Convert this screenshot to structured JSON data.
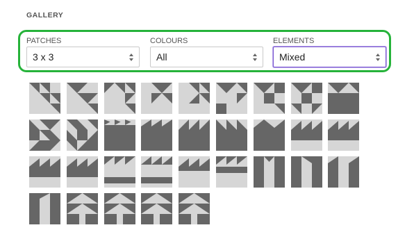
{
  "gallery": {
    "title": "GALLERY"
  },
  "filters": [
    {
      "label": "PATCHES",
      "value": "3 x 3"
    },
    {
      "label": "COLOURS",
      "value": "All"
    },
    {
      "label": "ELEMENTS",
      "value": "Mixed"
    }
  ],
  "colors": {
    "accent": "#26b33a",
    "dark": "#666666",
    "light": "#d6d6d6",
    "focus": "#7a57d1"
  },
  "thumbnails": [
    {
      "pattern": "tri-nw-1"
    },
    {
      "pattern": "tri-nw-2"
    },
    {
      "pattern": "tri-nw-3"
    },
    {
      "pattern": "tri-nw-4"
    },
    {
      "pattern": "tri-nw-5"
    },
    {
      "pattern": "tri-mix-1"
    },
    {
      "pattern": "tri-mix-2"
    },
    {
      "pattern": "tri-mix-3"
    },
    {
      "pattern": "tri-mix-4"
    },
    {
      "pattern": "quad-tri-1"
    },
    {
      "pattern": "quad-tri-2"
    },
    {
      "pattern": "saw-top-1"
    },
    {
      "pattern": "saw-top-2"
    },
    {
      "pattern": "saw-top-3"
    },
    {
      "pattern": "saw-top-4"
    },
    {
      "pattern": "saw-top-5"
    },
    {
      "pattern": "band-saw-1"
    },
    {
      "pattern": "band-saw-2"
    },
    {
      "pattern": "saw-low-1"
    },
    {
      "pattern": "saw-low-2"
    },
    {
      "pattern": "band-mid-1"
    },
    {
      "pattern": "band-mid-2"
    },
    {
      "pattern": "band-mid-3"
    },
    {
      "pattern": "band-mid-4"
    },
    {
      "pattern": "column-1"
    },
    {
      "pattern": "column-2"
    },
    {
      "pattern": "column-3"
    },
    {
      "pattern": "column-4"
    },
    {
      "pattern": "tree-1"
    },
    {
      "pattern": "tree-2"
    },
    {
      "pattern": "tree-3"
    },
    {
      "pattern": "tree-4"
    }
  ]
}
